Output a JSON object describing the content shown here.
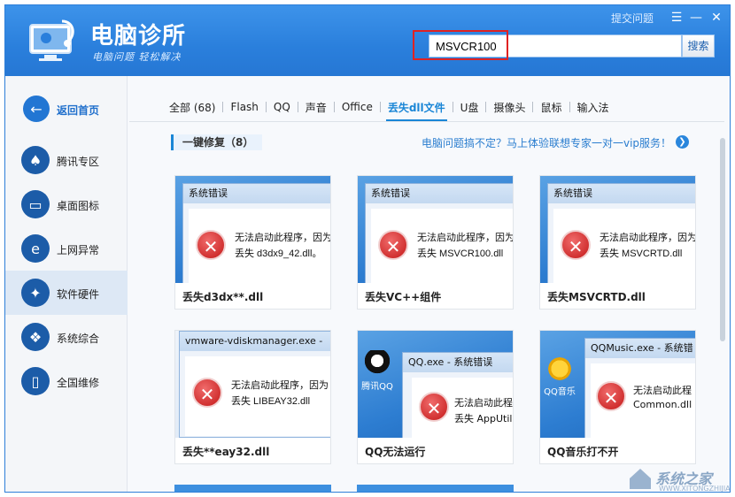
{
  "app": {
    "title": "电脑诊所",
    "slogan": "电脑问题 轻松解决",
    "feedback": "提交问题",
    "menu_icon": "menu-icon",
    "min_icon": "minimize-icon",
    "close_icon": "close-icon"
  },
  "search": {
    "value": "MSVCR100",
    "button": "搜索"
  },
  "sidebar": {
    "items": [
      {
        "label": "返回首页",
        "icon": "back-arrow-icon",
        "glyph": "←"
      },
      {
        "label": "腾讯专区",
        "icon": "qq-icon",
        "glyph": "♠"
      },
      {
        "label": "桌面图标",
        "icon": "monitor-icon",
        "glyph": "▭"
      },
      {
        "label": "上网异常",
        "icon": "ie-browser-icon",
        "glyph": "e"
      },
      {
        "label": "软件硬件",
        "icon": "hardware-icon",
        "glyph": "✦"
      },
      {
        "label": "系统综合",
        "icon": "windows-icon",
        "glyph": "❖"
      },
      {
        "label": "全国维修",
        "icon": "phone-repair-icon",
        "glyph": "▯"
      }
    ]
  },
  "tabs": [
    "全部 (68)",
    "Flash",
    "QQ",
    "声音",
    "Office",
    "丢失dll文件",
    "U盘",
    "摄像头",
    "鼠标",
    "输入法"
  ],
  "section": {
    "title": "一键修复（8）",
    "promo": "电脑问题搞不定？马上体验联想专家一对一vip服务！"
  },
  "cards": [
    {
      "title": "丢失d3dx**.dll",
      "dialog_title": "系统错误",
      "line1": "无法启动此程序，因为",
      "line2": "丢失 d3dx9_42.dll。"
    },
    {
      "title": "丢失VC++组件",
      "dialog_title": "系统错误",
      "line1": "无法启动此程序，因为",
      "line2": "丢失 MSVCR100.dll"
    },
    {
      "title": "丢失MSVCRTD.dll",
      "dialog_title": "系统错误",
      "line1": "无法启动此程序，因为",
      "line2": "丢失 MSVCRTD.dll"
    },
    {
      "title": "丢失**eay32.dll",
      "dialog_title": "vmware-vdiskmanager.exe -",
      "line1": "无法启动此程序，因为",
      "line2": "丢失 LIBEAY32.dll"
    },
    {
      "title": "QQ无法运行",
      "dialog_title": "QQ.exe - 系统错误",
      "line1": "无法启动此程序",
      "line2": "丢失 AppUtil.dll",
      "desktop_icon": "腾讯QQ"
    },
    {
      "title": "QQ音乐打不开",
      "dialog_title": "QQMusic.exe - 系统错",
      "line1": "无法启动此程",
      "line2": "Common.dll",
      "desktop_icon": "QQ音乐"
    }
  ],
  "watermark": {
    "text": "系统之家",
    "sub": "WWW.XITONGZHIJIA.NET"
  },
  "colors": {
    "header_blue": "#2a7fdc",
    "accent": "#1a86d6",
    "error_red": "#c41818"
  }
}
